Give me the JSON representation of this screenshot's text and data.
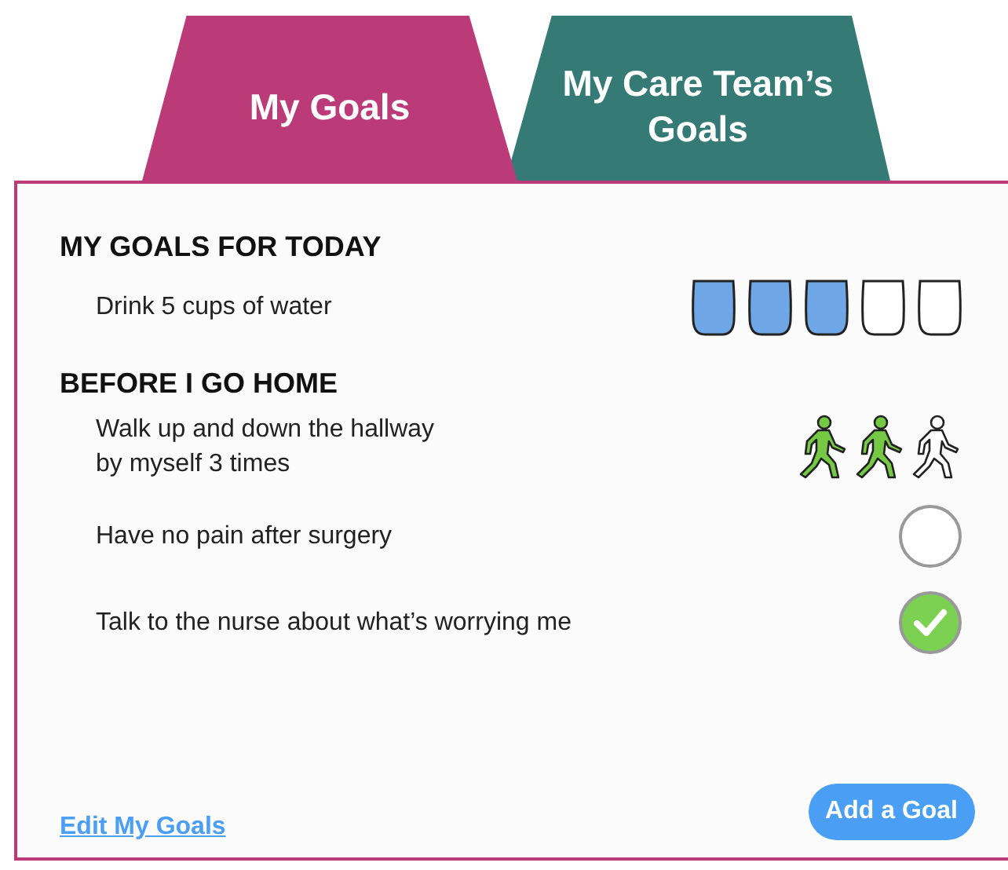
{
  "tabs": [
    {
      "label": "My Goals",
      "selected": true,
      "color": "#bb3a78"
    },
    {
      "label": "My Care Team’s Goals",
      "selected": false,
      "color": "#367a76"
    }
  ],
  "sections": [
    {
      "title": "MY GOALS FOR TODAY",
      "goals": [
        {
          "kind": "cups",
          "text": "Drink 5 cups of water",
          "marks": [
            {
              "done": true
            },
            {
              "done": true
            },
            {
              "done": true
            },
            {
              "done": false
            },
            {
              "done": false
            }
          ]
        }
      ]
    },
    {
      "title": "BEFORE I GO HOME",
      "goals": [
        {
          "kind": "walks",
          "text": "Walk up and down the hallway\nby myself 3 times",
          "marks": [
            {
              "done": true
            },
            {
              "done": true
            },
            {
              "done": false
            }
          ]
        },
        {
          "kind": "check",
          "text": "Have no pain after surgery",
          "checked": false
        },
        {
          "kind": "check",
          "text": "Talk to the nurse about what’s worrying me",
          "checked": true
        }
      ]
    }
  ],
  "footer": {
    "link": "Edit My Goals",
    "button": "Add a Goal"
  }
}
